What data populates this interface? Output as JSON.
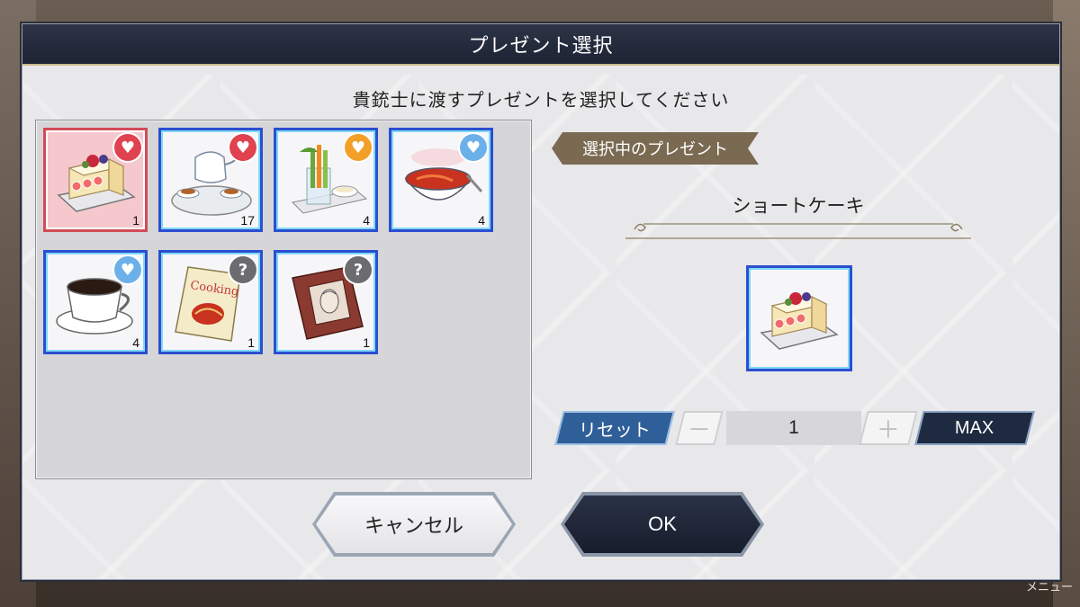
{
  "dialog": {
    "title": "プレゼント選択",
    "subtitle": "貴銃士に渡すプレゼントを選択してください"
  },
  "items": [
    {
      "name": "short-cake",
      "count": "1",
      "badge": "red-heart",
      "selected": true
    },
    {
      "name": "tea-set",
      "count": "17",
      "badge": "red-heart"
    },
    {
      "name": "vegetable-sticks",
      "count": "4",
      "badge": "orange-heart"
    },
    {
      "name": "tomato-soup",
      "count": "4",
      "badge": "half-blue-heart"
    },
    {
      "name": "coffee-cup",
      "count": "4",
      "badge": "half-blue-heart"
    },
    {
      "name": "cooking-book",
      "count": "1",
      "badge": "question"
    },
    {
      "name": "portrait-book",
      "count": "1",
      "badge": "question"
    }
  ],
  "selection": {
    "tag": "選択中のプレゼント",
    "name": "ショートケーキ",
    "quantity": "1"
  },
  "controls": {
    "reset": "リセット",
    "minus": "－",
    "plus": "＋",
    "max": "MAX"
  },
  "footer": {
    "cancel": "キャンセル",
    "ok": "OK"
  },
  "background": {
    "menu_label": "メニュー"
  },
  "colors": {
    "title_bar": "#1d2333",
    "selected_item_border": "#d24b57",
    "item_border": "#2b4fd0",
    "reset_button": "#2f5f98",
    "max_button": "#1d2a40"
  }
}
